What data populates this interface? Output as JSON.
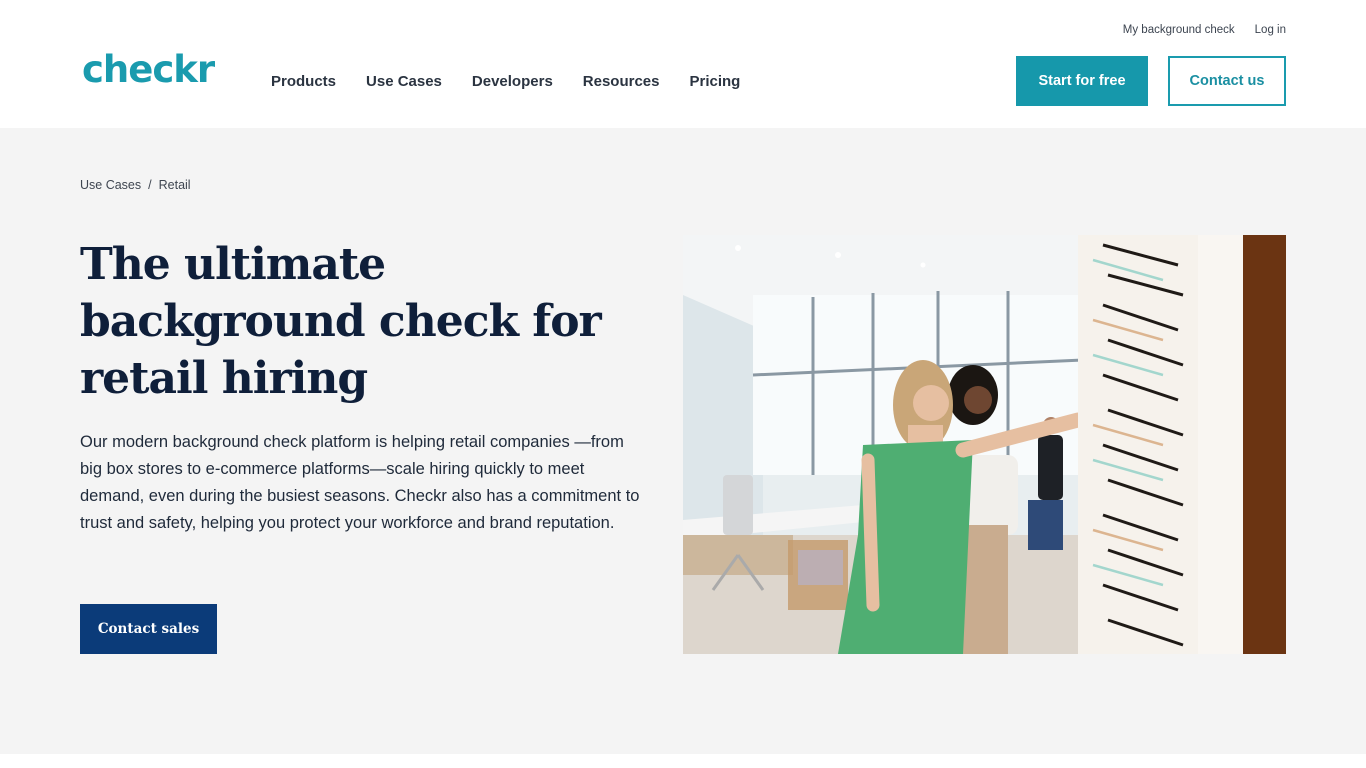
{
  "header": {
    "logo_text": "checkr",
    "nav": [
      "Products",
      "Use Cases",
      "Developers",
      "Resources",
      "Pricing"
    ],
    "utility_links": [
      "My background check",
      "Log in"
    ],
    "start_button": "Start for free",
    "contact_button": "Contact us"
  },
  "hero": {
    "breadcrumb": [
      {
        "label": "Use Cases"
      },
      {
        "label": "Retail"
      }
    ],
    "breadcrumb_separator": "/",
    "title": "The ultimate background check for retail hiring",
    "description": "Our modern background check platform is helping retail companies —from big box stores to e-commerce platforms—scale hiring quickly to meet demand, even during the busiest seasons. Checkr also has a commitment to trust and safety, helping you protect your workforce and brand reputation.",
    "cta_button": "Contact sales",
    "image_alt": "Two women browsing eyeglass frames on a display wall in a retail optical store"
  },
  "colors": {
    "brand_teal": "#1a9bae",
    "navy": "#0b3b79",
    "heading": "#0f1f3a",
    "hero_bg": "#f4f4f4"
  }
}
